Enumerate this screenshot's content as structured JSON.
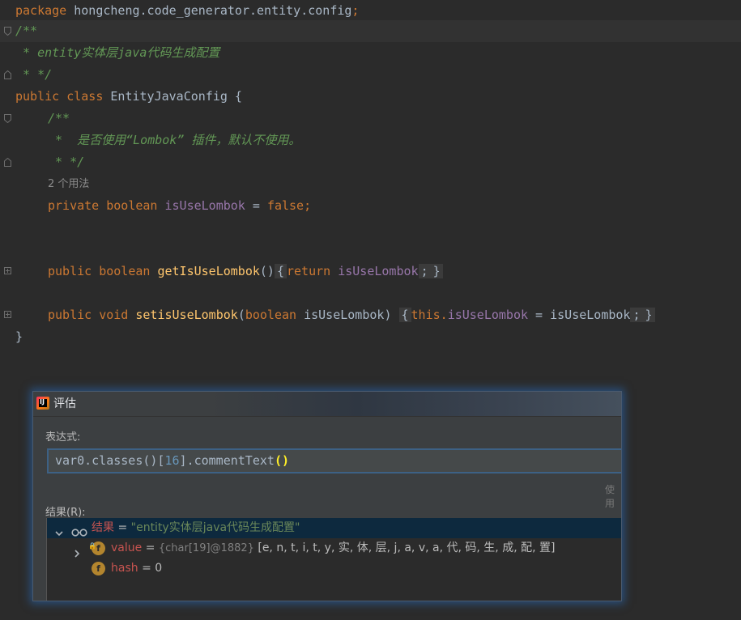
{
  "editor": {
    "line1": {
      "kw": "package",
      "text": " hongcheng.code_generator.entity.config",
      "semi": ";"
    },
    "line2": "/**",
    "line3": " * entity实体层java代码生成配置",
    "line4": " * */",
    "line5": {
      "kw1": "public",
      "kw2": "class",
      "name": " EntityJavaConfig {"
    },
    "line6": "/**",
    "line7": " *  是否使用“Lombok” 插件，默认不使用。",
    "line8": " * */",
    "usage_hint": "2 个用法",
    "line10": {
      "kw1": "private",
      "kw2": "boolean",
      "field": "isUseLombok",
      "eq": " = ",
      "val": "false",
      "semi": ";"
    },
    "line13": {
      "kw1": "public",
      "kw2": "boolean",
      "method": "getIsUseLombok",
      "parens": "()",
      "ob": "{",
      "ret": "return",
      "field": "isUseLombok",
      "semi": ";",
      "cb": "}"
    },
    "line15": {
      "kw1": "public",
      "kw2": "void",
      "method": "setisUseLombok",
      "op": "(",
      "ptype": "boolean",
      "pname": " isUseLombok",
      "cp": ")",
      "ob": "{",
      "this": "this",
      "dot": ".",
      "field": "isUseLombok",
      "assign": " = isUseLombok",
      "semi": ";",
      "cb": "}"
    },
    "line16": "}"
  },
  "dialog": {
    "title": "评估",
    "app_icon": "intellij-icon",
    "expression_label": "表达式:",
    "expression": {
      "pre": "var0.classes()[",
      "num": "16",
      "post": "].commentText",
      "paren": "()"
    },
    "use_hint": "使用",
    "result_label": "结果(R):",
    "result_tree": [
      {
        "name": "结果",
        "eq": " = ",
        "value": "\"entity实体层java代码生成配置\"",
        "expanded": true,
        "icon": "glasses-icon"
      },
      {
        "name": "value",
        "eq": " = ",
        "type": "{char[19]@1882}",
        "value": " [e, n, t, i, t, y, 实, 体, 层, j, a, v, a, 代, 码, 生, 成, 配, 置]",
        "expanded": false,
        "icon": "field-icon"
      },
      {
        "name": "hash",
        "eq": " = ",
        "value": "0",
        "icon": "field-icon"
      }
    ],
    "field_icon_letter": "f"
  }
}
